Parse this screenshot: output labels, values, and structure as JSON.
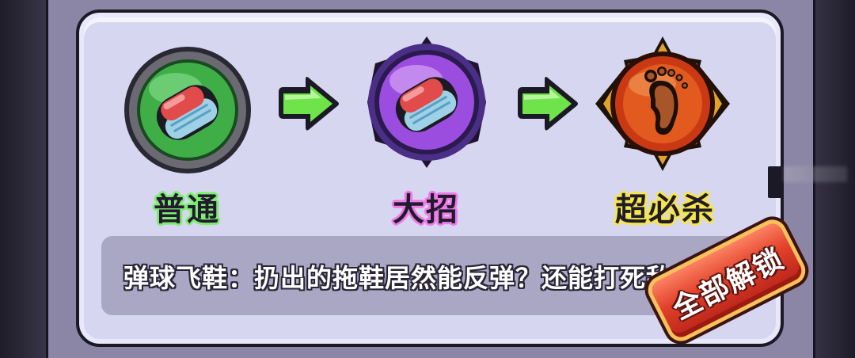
{
  "skills": {
    "normal": {
      "label": "普通",
      "color": "#7cf06e",
      "icon": "slipper-icon"
    },
    "ultimate": {
      "label": "大招",
      "color": "#ef7ae8",
      "icon": "slipper-icon"
    },
    "super": {
      "label": "超必杀",
      "color": "#f6e64a",
      "icon": "footprint-icon"
    }
  },
  "description": "弹球飞鞋：扔出的拖鞋居然能反弹？还能打死敌",
  "unlock_button": {
    "label": "全部解锁",
    "color": "#e2402a"
  },
  "arrow_color": "#6fe34a"
}
